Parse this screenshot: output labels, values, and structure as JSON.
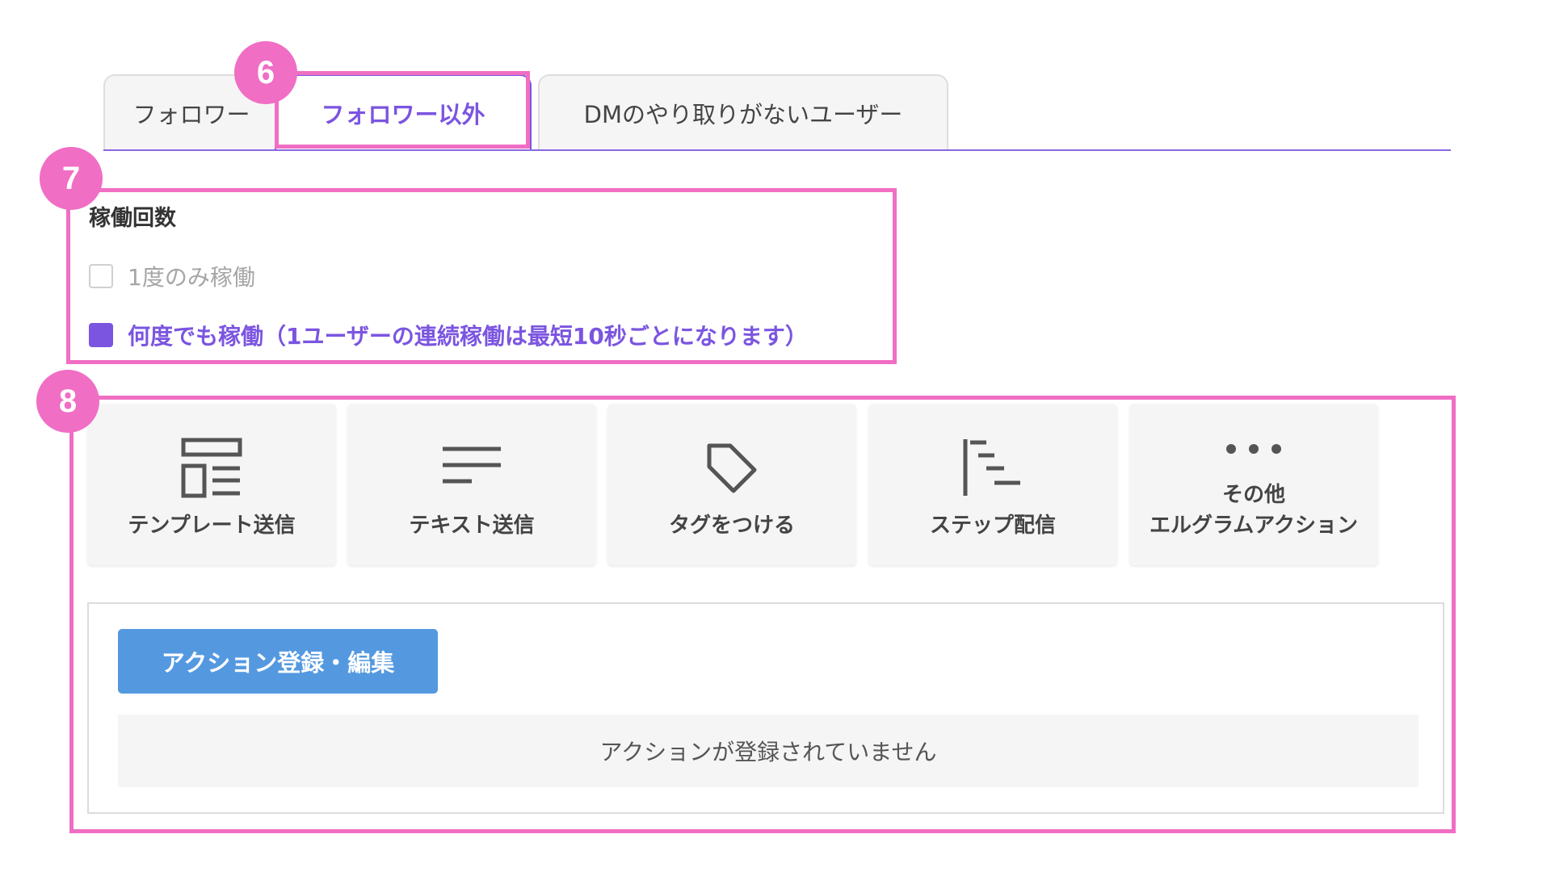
{
  "tabs": [
    {
      "label": "フォロワー",
      "active": false
    },
    {
      "label": "フォロワー以外",
      "active": true
    },
    {
      "label": "DMのやり取りがないユーザー",
      "active": false
    }
  ],
  "badges": {
    "tabs": "6",
    "frequency": "7",
    "actions": "8"
  },
  "frequency": {
    "title": "稼働回数",
    "options": [
      {
        "label": "1度のみ稼働",
        "checked": false
      },
      {
        "label": "何度でも稼働（1ユーザーの連続稼働は最短10秒ごとになります）",
        "checked": true
      }
    ]
  },
  "action_types": [
    {
      "label": "テンプレート送信",
      "icon": "template-icon"
    },
    {
      "label": "テキスト送信",
      "icon": "text-lines-icon"
    },
    {
      "label": "タグをつける",
      "icon": "tag-icon"
    },
    {
      "label": "ステップ配信",
      "icon": "step-delivery-icon"
    },
    {
      "label_line1": "その他",
      "label_line2": "エルグラムアクション",
      "icon": "more-dots-icon"
    }
  ],
  "action_panel": {
    "button_label": "アクション登録・編集",
    "empty_message": "アクションが登録されていません"
  },
  "colors": {
    "accent": "#7b55e0",
    "highlight": "#f06ec4",
    "button": "#5499e0"
  }
}
